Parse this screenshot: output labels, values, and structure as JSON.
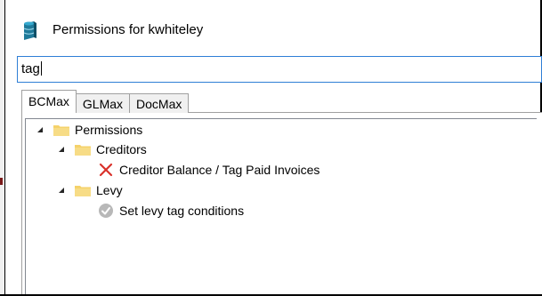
{
  "window": {
    "title": "Permissions for kwhiteley",
    "icon": "database-icon"
  },
  "search": {
    "value": "tag",
    "placeholder": ""
  },
  "tabs": [
    {
      "label": "BCMax",
      "active": true
    },
    {
      "label": "GLMax",
      "active": false
    },
    {
      "label": "DocMax",
      "active": false
    }
  ],
  "tree": {
    "root": {
      "label": "Permissions",
      "expanded": true,
      "icon": "folder-icon"
    },
    "creditors": {
      "label": "Creditors",
      "expanded": true,
      "icon": "folder-icon"
    },
    "creditor_balance": {
      "label": "Creditor Balance / Tag Paid Invoices",
      "icon": "red-x-icon"
    },
    "levy": {
      "label": "Levy",
      "expanded": true,
      "icon": "folder-icon"
    },
    "levy_tag": {
      "label": "Set levy tag conditions",
      "icon": "grey-check-icon"
    }
  },
  "colors": {
    "accent": "#2f7fd6",
    "folder": "#f5d26a",
    "deny": "#d9312b",
    "neutral_check": "#b8b8b8"
  }
}
